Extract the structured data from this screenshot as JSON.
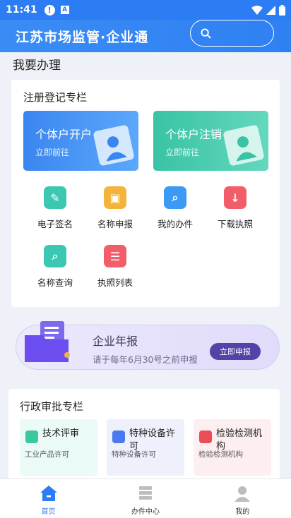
{
  "status_bar": {
    "time": "11:41"
  },
  "header": {
    "title": "江苏市场监管·企业通",
    "search_placeholder": ""
  },
  "main": {
    "section_title": "我要办理",
    "register": {
      "title": "注册登记专栏",
      "banners": [
        {
          "name": "个体户开户",
          "sub": "立即前往"
        },
        {
          "name": "个体户注销",
          "sub": "立即前往"
        }
      ],
      "services": [
        {
          "label": "电子签名",
          "icon": "signature-icon"
        },
        {
          "label": "名称申报",
          "icon": "name-declare-icon"
        },
        {
          "label": "我的办件",
          "icon": "my-cases-icon"
        },
        {
          "label": "下载执照",
          "icon": "download-license-icon"
        },
        {
          "label": "名称查询",
          "icon": "name-search-icon"
        },
        {
          "label": "执照列表",
          "icon": "license-list-icon"
        }
      ]
    },
    "annual_report": {
      "title": "企业年报",
      "sub": "请于每年6月30号之前申报",
      "button": "立即申报"
    },
    "admin": {
      "title": "行政审批专栏",
      "items": [
        {
          "name": "技术评审",
          "sub": "工业产品许可"
        },
        {
          "name": "特种设备许可",
          "sub": "特种设备许可"
        },
        {
          "name": "检验检测机构",
          "sub": "检验检测机构"
        }
      ]
    }
  },
  "bottom_nav": [
    {
      "label": "首页",
      "icon": "home-icon",
      "active": true
    },
    {
      "label": "办件中心",
      "icon": "cases-center-icon",
      "active": false
    },
    {
      "label": "我的",
      "icon": "profile-icon",
      "active": false
    }
  ],
  "colors": {
    "primary": "#2c7cf3",
    "teal": "#39c3a4",
    "purple": "#5442a8"
  }
}
